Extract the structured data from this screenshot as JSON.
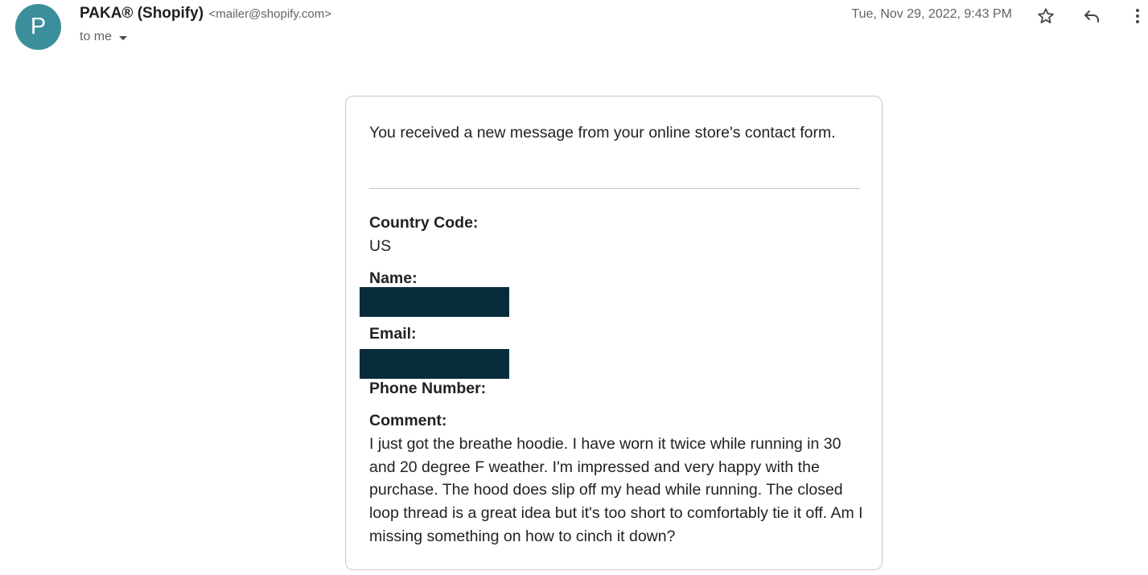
{
  "sender": {
    "avatar_letter": "P",
    "name": "PAKA® (Shopify)",
    "email": "<mailer@shopify.com>",
    "to_label": "to me",
    "date": "Tue, Nov 29, 2022, 9:43 PM"
  },
  "toolbar_icons": [
    "star-icon",
    "reply-icon",
    "more-vert-icon"
  ],
  "message": {
    "intro": "You received a new message from your online store's contact form.",
    "fields": {
      "country_label": "Country Code:",
      "country_value": "US",
      "name_label": "Name:",
      "email_label": "Email:",
      "phone_label": "Phone Number:",
      "comment_label": "Comment:",
      "comment_value": "I just got the breathe hoodie. I have worn it twice while running in 30 and 20 degree F weather. I'm impressed and very happy with the purchase. The hood does slip off my head while running. The closed loop thread is a great idea but it's too short to comfortably tie it off. Am I missing something on how to cinch it down?"
    }
  },
  "colors": {
    "avatar_bg": "#3b8f9c",
    "redaction": "#082c3a",
    "card_border": "#c8c8c8"
  }
}
